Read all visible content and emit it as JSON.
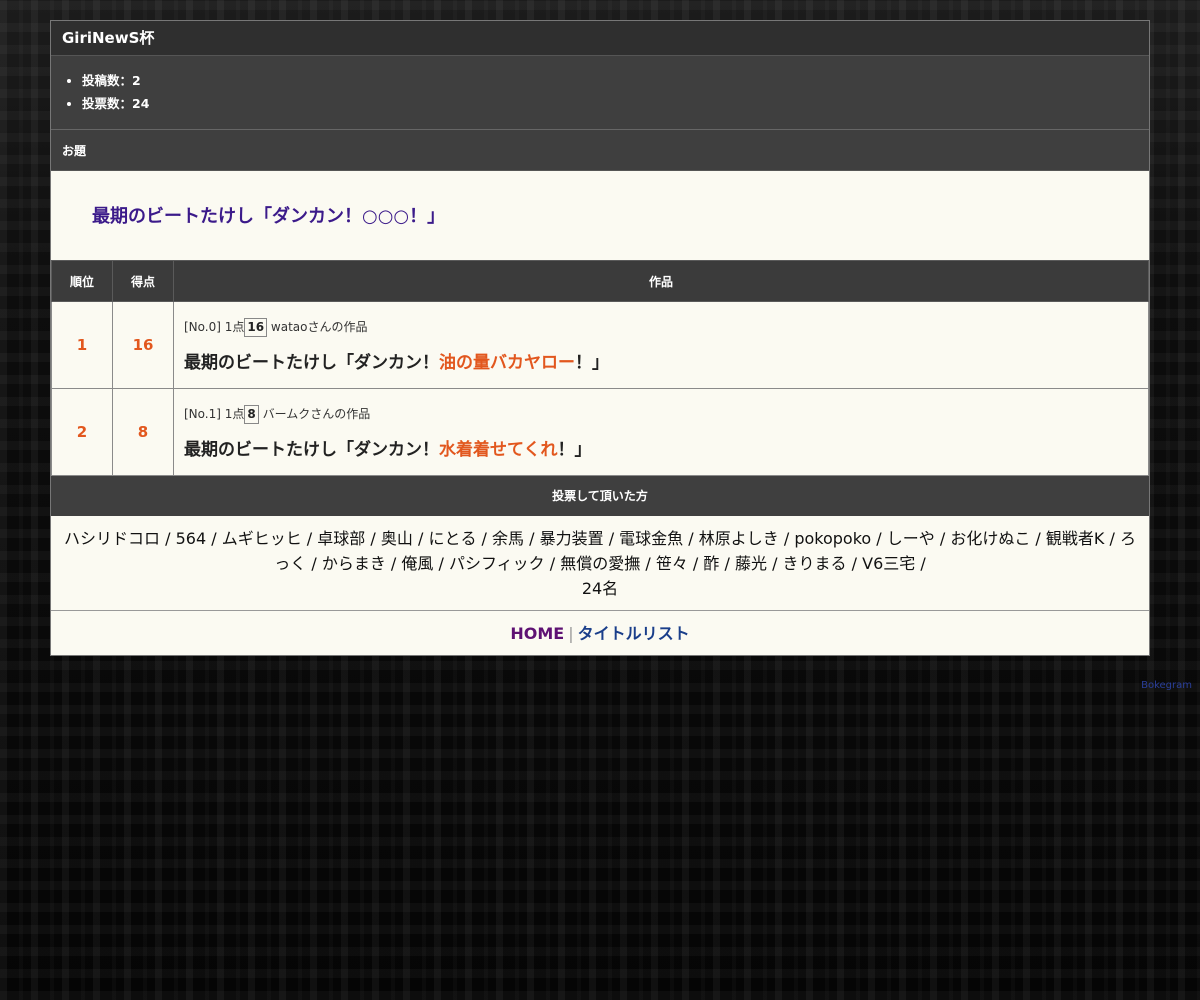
{
  "header": {
    "title": "GiriNewS杯"
  },
  "stats": [
    "投稿数：2",
    "投票数：24"
  ],
  "odai": {
    "label": "お題",
    "text": "最期のビートたけし「ダンカン！○○○！」"
  },
  "table": {
    "headers": [
      "順位",
      "得点",
      "作品"
    ],
    "rows": [
      {
        "rank": "1",
        "score": "16",
        "no": "[No.0]",
        "per": "1点",
        "points": "16",
        "author": "wataoさんの作品",
        "before": "最期のビートたけし「ダンカン！",
        "fill": "油の量バカヤロー",
        "after": "！」"
      },
      {
        "rank": "2",
        "score": "8",
        "no": "[No.1]",
        "per": "1点",
        "points": "8",
        "author": "バームクさんの作品",
        "before": "最期のビートたけし「ダンカン！",
        "fill": "水着着せてくれ",
        "after": "！」"
      }
    ]
  },
  "voters": {
    "heading": "投票して頂いた方",
    "names": [
      "ハシリドコロ",
      "564",
      "ムギヒッヒ",
      "卓球部",
      "奥山",
      "にとる",
      "余馬",
      "暴力装置",
      "電球金魚",
      "林原よしき",
      "pokopoko",
      "しーや",
      "お化けぬこ",
      "観戦者K",
      "ろっく",
      "からまき",
      "俺風",
      "パシフィック",
      "無償の愛撫",
      "笹々",
      "酢",
      "藤光",
      "きりまる",
      "V6三宅"
    ],
    "count": "24名"
  },
  "footer": {
    "home": "HOME",
    "separator": "|",
    "list": "タイトルリスト"
  },
  "credit": "Bokegram",
  "colors": {
    "accent": "#e2571e",
    "odai": "#3b1a8a",
    "header_bg": "#3f3f3f"
  }
}
